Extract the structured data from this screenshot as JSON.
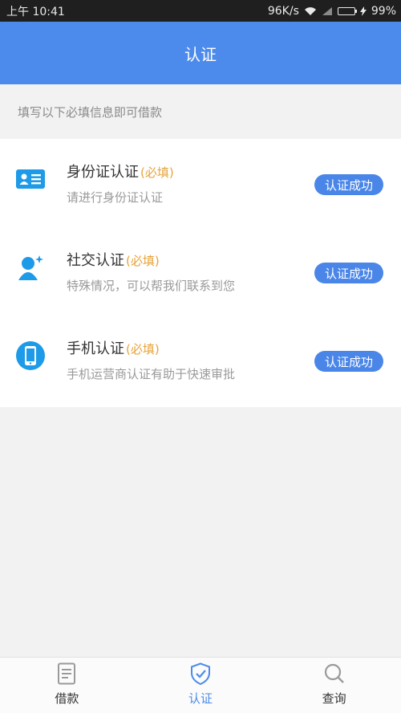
{
  "status_bar": {
    "time": "上午 10:41",
    "network_speed": "96K/s",
    "battery": "99%"
  },
  "header": {
    "title": "认证"
  },
  "notice": "填写以下必填信息即可借款",
  "items": [
    {
      "title": "身份证认证",
      "required": "(必填)",
      "desc": "请进行身份证认证",
      "status": "认证成功",
      "icon": "id-card-icon"
    },
    {
      "title": "社交认证",
      "required": "(必填)",
      "desc": "特殊情况，可以帮我们联系到您",
      "status": "认证成功",
      "icon": "social-contact-icon"
    },
    {
      "title": "手机认证",
      "required": "(必填)",
      "desc": "手机运营商认证有助于快速审批",
      "status": "认证成功",
      "icon": "mobile-phone-icon"
    }
  ],
  "tabs": [
    {
      "label": "借款",
      "icon": "document-icon"
    },
    {
      "label": "认证",
      "icon": "shield-check-icon",
      "active": true
    },
    {
      "label": "查询",
      "icon": "search-icon"
    }
  ],
  "colors": {
    "brand": "#4c8bec",
    "required": "#e7a33a",
    "status_bar": "#1f1f1f"
  }
}
